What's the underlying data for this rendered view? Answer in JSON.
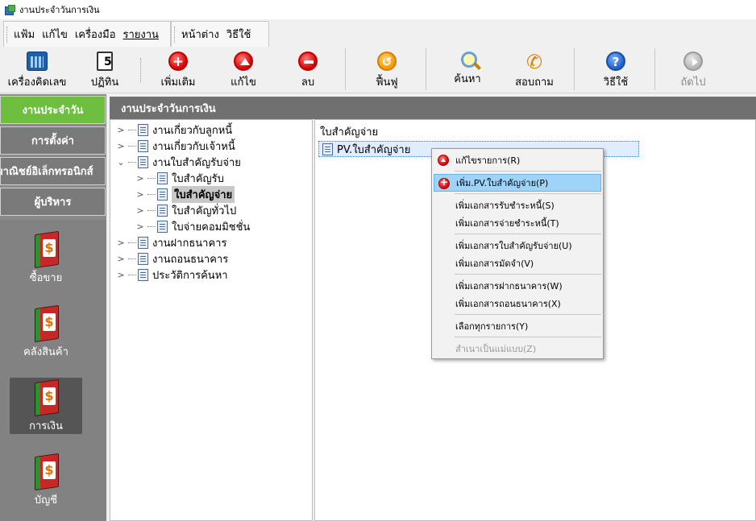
{
  "window": {
    "title": "งานประจำวันการเงิน"
  },
  "menu": {
    "group1": [
      "แฟ้ม",
      "แก้ไข",
      "เครื่องมือ",
      "รายงาน"
    ],
    "group2": [
      "หน้าต่าง",
      "วิธีใช้"
    ]
  },
  "toolbar": {
    "calculator": "เครื่องคิดเลข",
    "calendar": "ปฏิทิน",
    "add": "เพิ่มเติม",
    "edit": "แก้ไข",
    "delete": "ลบ",
    "restore": "ฟื้นฟู",
    "search": "ค้นหา",
    "inquiry": "สอบถาม",
    "help": "วิธีใช้",
    "next": "ถัดไป"
  },
  "leftnav": {
    "tabs": [
      "งานประจำวัน",
      "การตั้งค่า",
      "พาณิชย์อิเล็กทรอนิกส์",
      "ผู้บริหาร"
    ],
    "modules": [
      "ซื้อขาย",
      "คลังสินค้า",
      "การเงิน",
      "บัญชี"
    ]
  },
  "main": {
    "title": "งานประจำวันการเงิน"
  },
  "tree": {
    "n1": "งานเกี่ยวกับลูกหนี้",
    "n2": "งานเกี่ยวกับเจ้าหนี้",
    "n3": "งานใบสำคัญรับจ่าย",
    "n3a": "ใบสำคัญรับ",
    "n3b": "ใบสำคัญจ่าย",
    "n3c": "ใบสำคัญทั่วไป",
    "n3d": "ใบจ่ายคอมมิชชั่น",
    "n4": "งานฝากธนาคาร",
    "n5": "งานถอนธนาคาร",
    "n6": "ประวัติการค้นหา"
  },
  "list": {
    "header": "ใบสำคัญจ่าย",
    "row1": "PV.ใบสำคัญจ่าย"
  },
  "context_menu": {
    "edit_list": "แก้ไขรายการ(R)",
    "add_pv": "เพิ่ม.PV.ใบสำคัญจ่าย(P)",
    "add_receipt": "เพิ่มเอกสารรับชำระหนี้(S)",
    "add_payment": "เพิ่มเอกสารจ่ายชำระหนี้(T)",
    "add_voucher": "เพิ่มเอกสารใบสำคัญรับจ่าย(U)",
    "add_deposit": "เพิ่มเอกสารมัดจำ(V)",
    "add_bank_deposit": "เพิ่มเอกสารฝากธนาคาร(W)",
    "add_bank_withdraw": "เพิ่มเอกสารถอนธนาคาร(X)",
    "select_all": "เลือกทุกรายการ(Y)",
    "copy_template": "สำเนาเป็นแม่แบบ(Z)"
  }
}
